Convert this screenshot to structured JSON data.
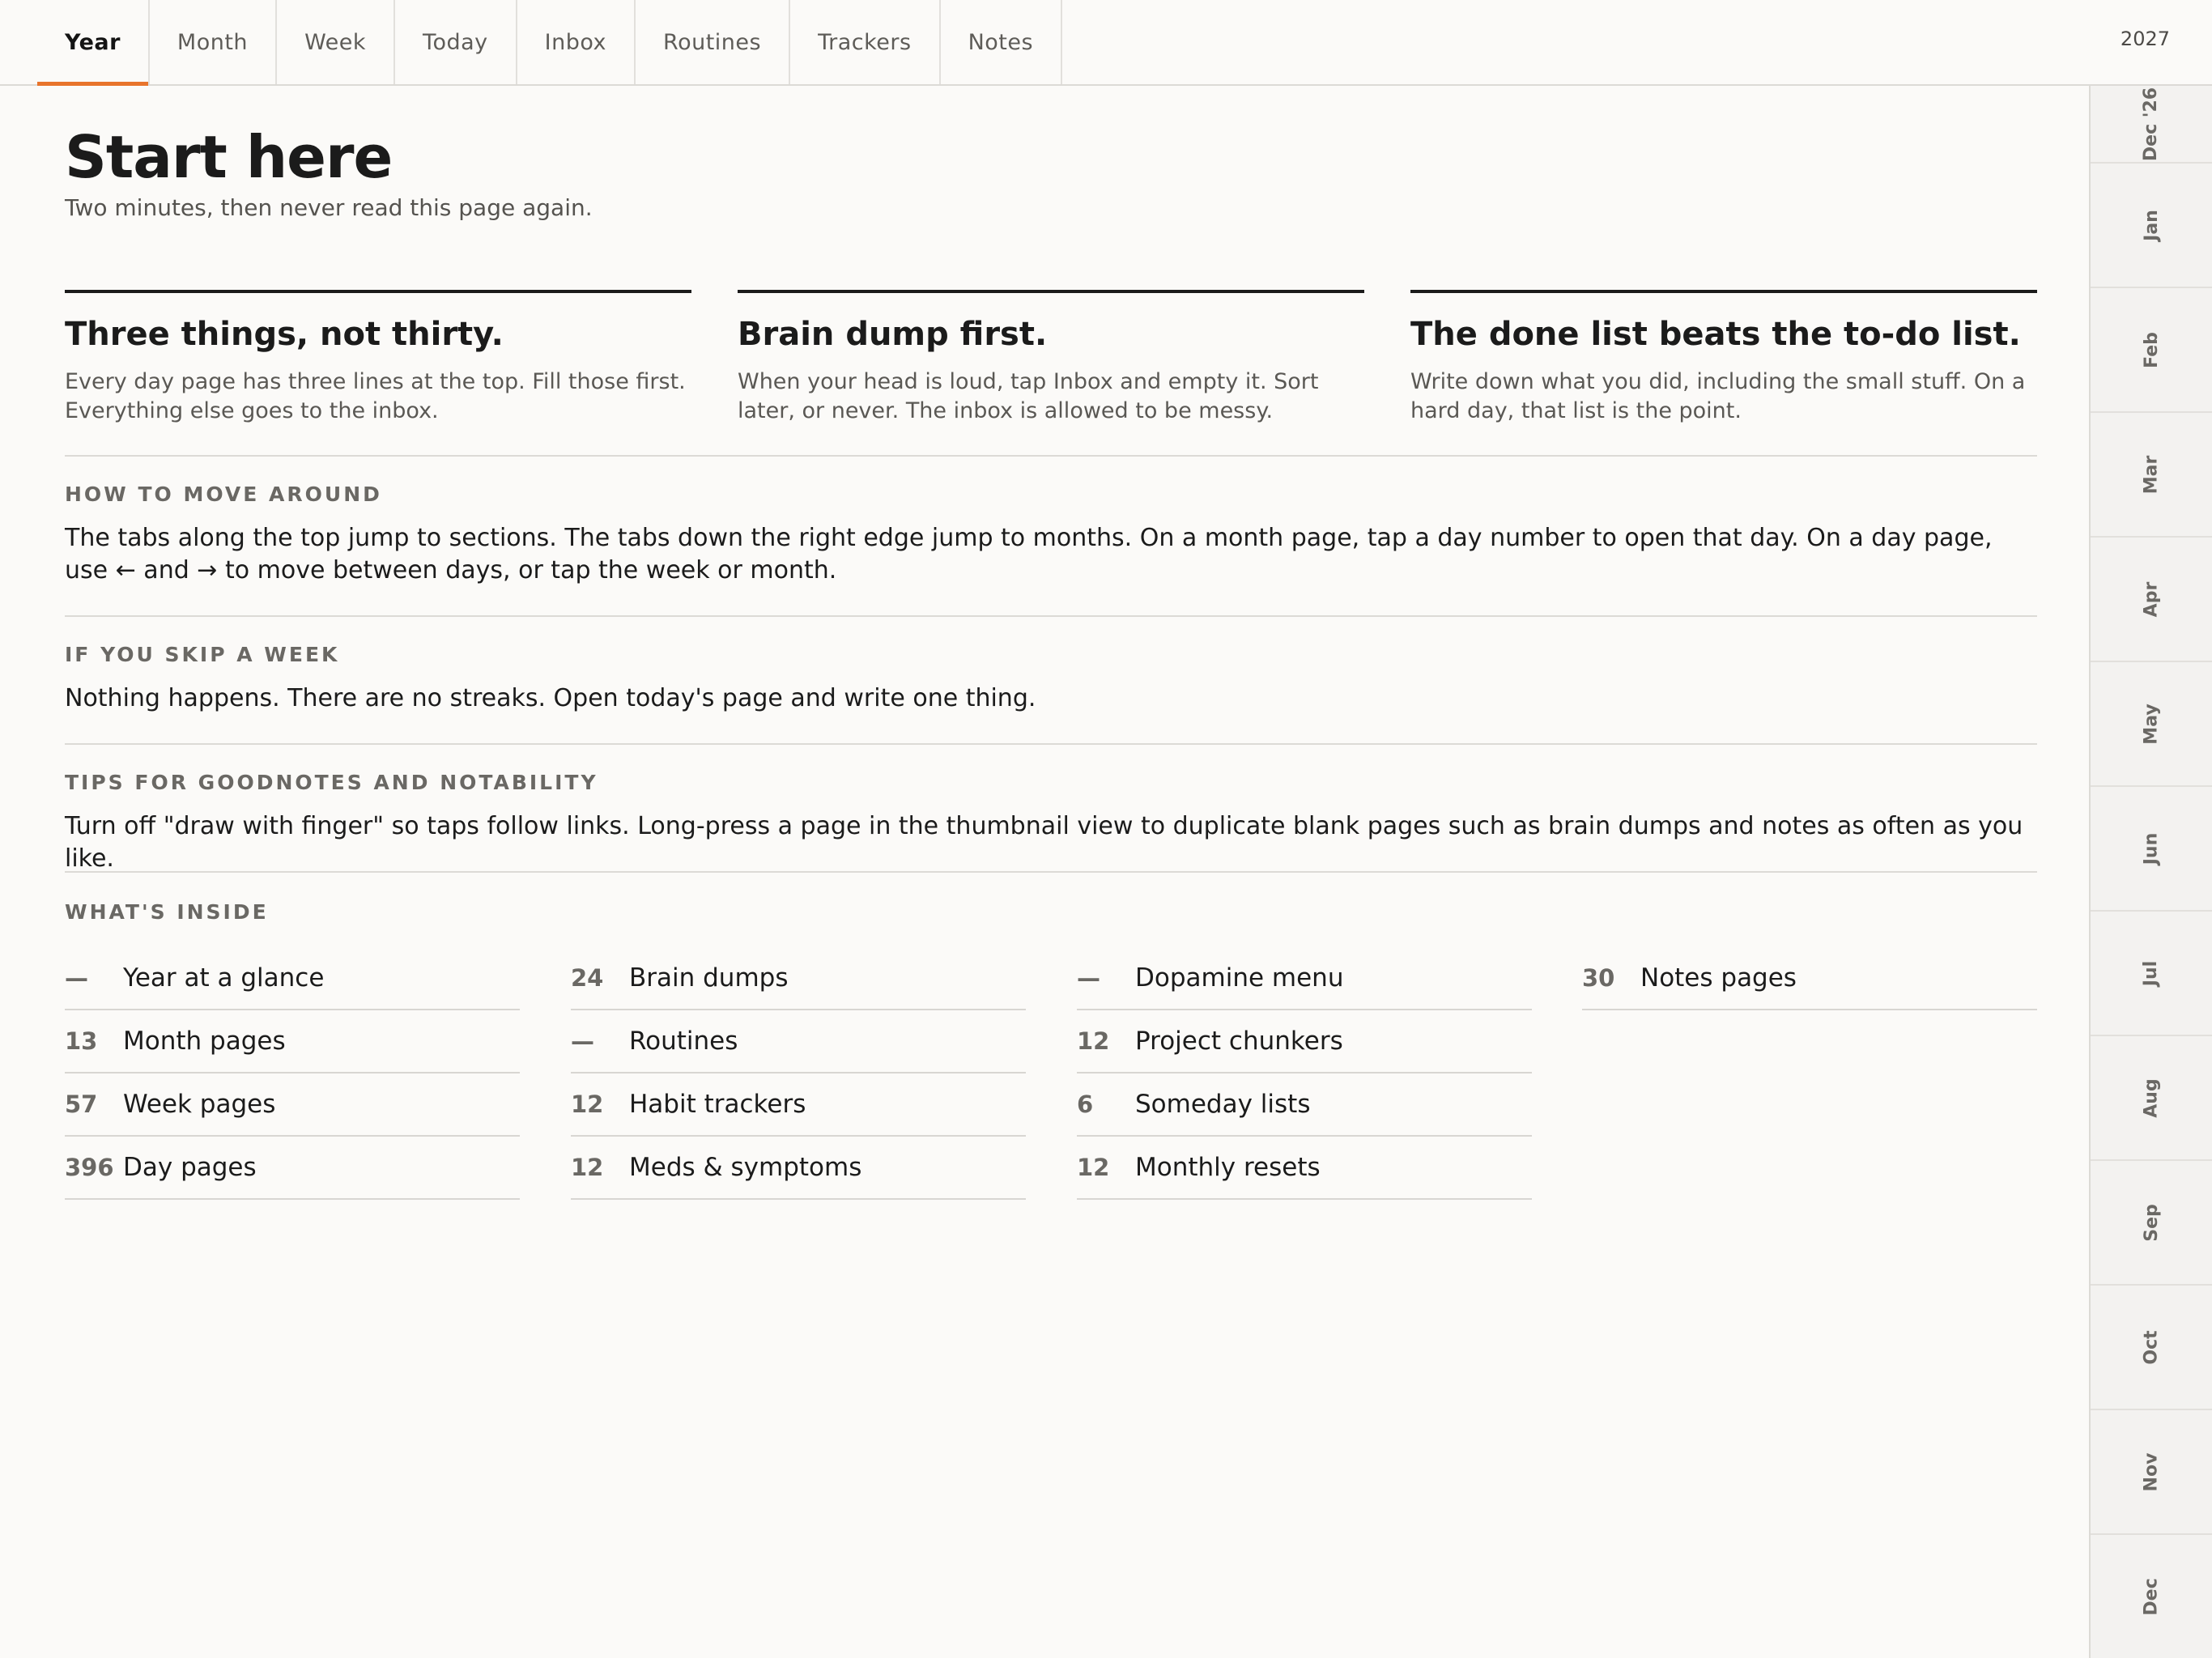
{
  "tabs": [
    {
      "label": "Year",
      "active": true
    },
    {
      "label": "Month"
    },
    {
      "label": "Week"
    },
    {
      "label": "Today"
    },
    {
      "label": "Inbox"
    },
    {
      "label": "Routines"
    },
    {
      "label": "Trackers"
    },
    {
      "label": "Notes"
    }
  ],
  "year": "2027",
  "months": [
    "Dec '26",
    "Jan",
    "Feb",
    "Mar",
    "Apr",
    "May",
    "Jun",
    "Jul",
    "Aug",
    "Sep",
    "Oct",
    "Nov",
    "Dec"
  ],
  "page": {
    "title": "Start here",
    "subtitle": "Two minutes, then never read this page again."
  },
  "cards": [
    {
      "title": "Three things, not thirty.",
      "body": "Every day page has three lines at the top. Fill those first. Everything else goes to the inbox."
    },
    {
      "title": "Brain dump first.",
      "body": "When your head is loud, tap Inbox and empty it. Sort later, or never. The inbox is allowed to be messy."
    },
    {
      "title": "The done list beats the to-do list.",
      "body": "Write down what you did, including the small stuff. On a hard day, that list is the point."
    }
  ],
  "sections": [
    {
      "label": "HOW TO MOVE AROUND",
      "body": "The tabs along the top jump to sections. The tabs down the right edge jump to months. On a month page, tap a day number to open that day. On a day page, use ← and → to move between days, or tap the week or month."
    },
    {
      "label": "IF YOU SKIP A WEEK",
      "body": "Nothing happens. There are no streaks. Open today's page and write one thing."
    },
    {
      "label": "TIPS FOR GOODNOTES AND NOTABILITY",
      "body": "Turn off \"draw with finger\" so taps follow links. Long-press a page in the thumbnail view to duplicate blank pages such as brain dumps and notes as often as you like."
    }
  ],
  "inside": {
    "label": "WHAT'S INSIDE",
    "columns": [
      [
        {
          "count": "—",
          "name": "Year at a glance"
        },
        {
          "count": "13",
          "name": "Month pages"
        },
        {
          "count": "57",
          "name": "Week pages"
        },
        {
          "count": "396",
          "name": "Day pages"
        }
      ],
      [
        {
          "count": "24",
          "name": "Brain dumps"
        },
        {
          "count": "—",
          "name": "Routines"
        },
        {
          "count": "12",
          "name": "Habit trackers"
        },
        {
          "count": "12",
          "name": "Meds & symptoms"
        }
      ],
      [
        {
          "count": "—",
          "name": "Dopamine menu"
        },
        {
          "count": "12",
          "name": "Project chunkers"
        },
        {
          "count": "6",
          "name": "Someday lists"
        },
        {
          "count": "12",
          "name": "Monthly resets"
        }
      ],
      [
        {
          "count": "30",
          "name": "Notes pages"
        }
      ]
    ]
  },
  "colors": {
    "accent": "#e8742c",
    "text": "#1b1b1b",
    "muted": "#6a6864",
    "background": "#fbfaf8"
  }
}
